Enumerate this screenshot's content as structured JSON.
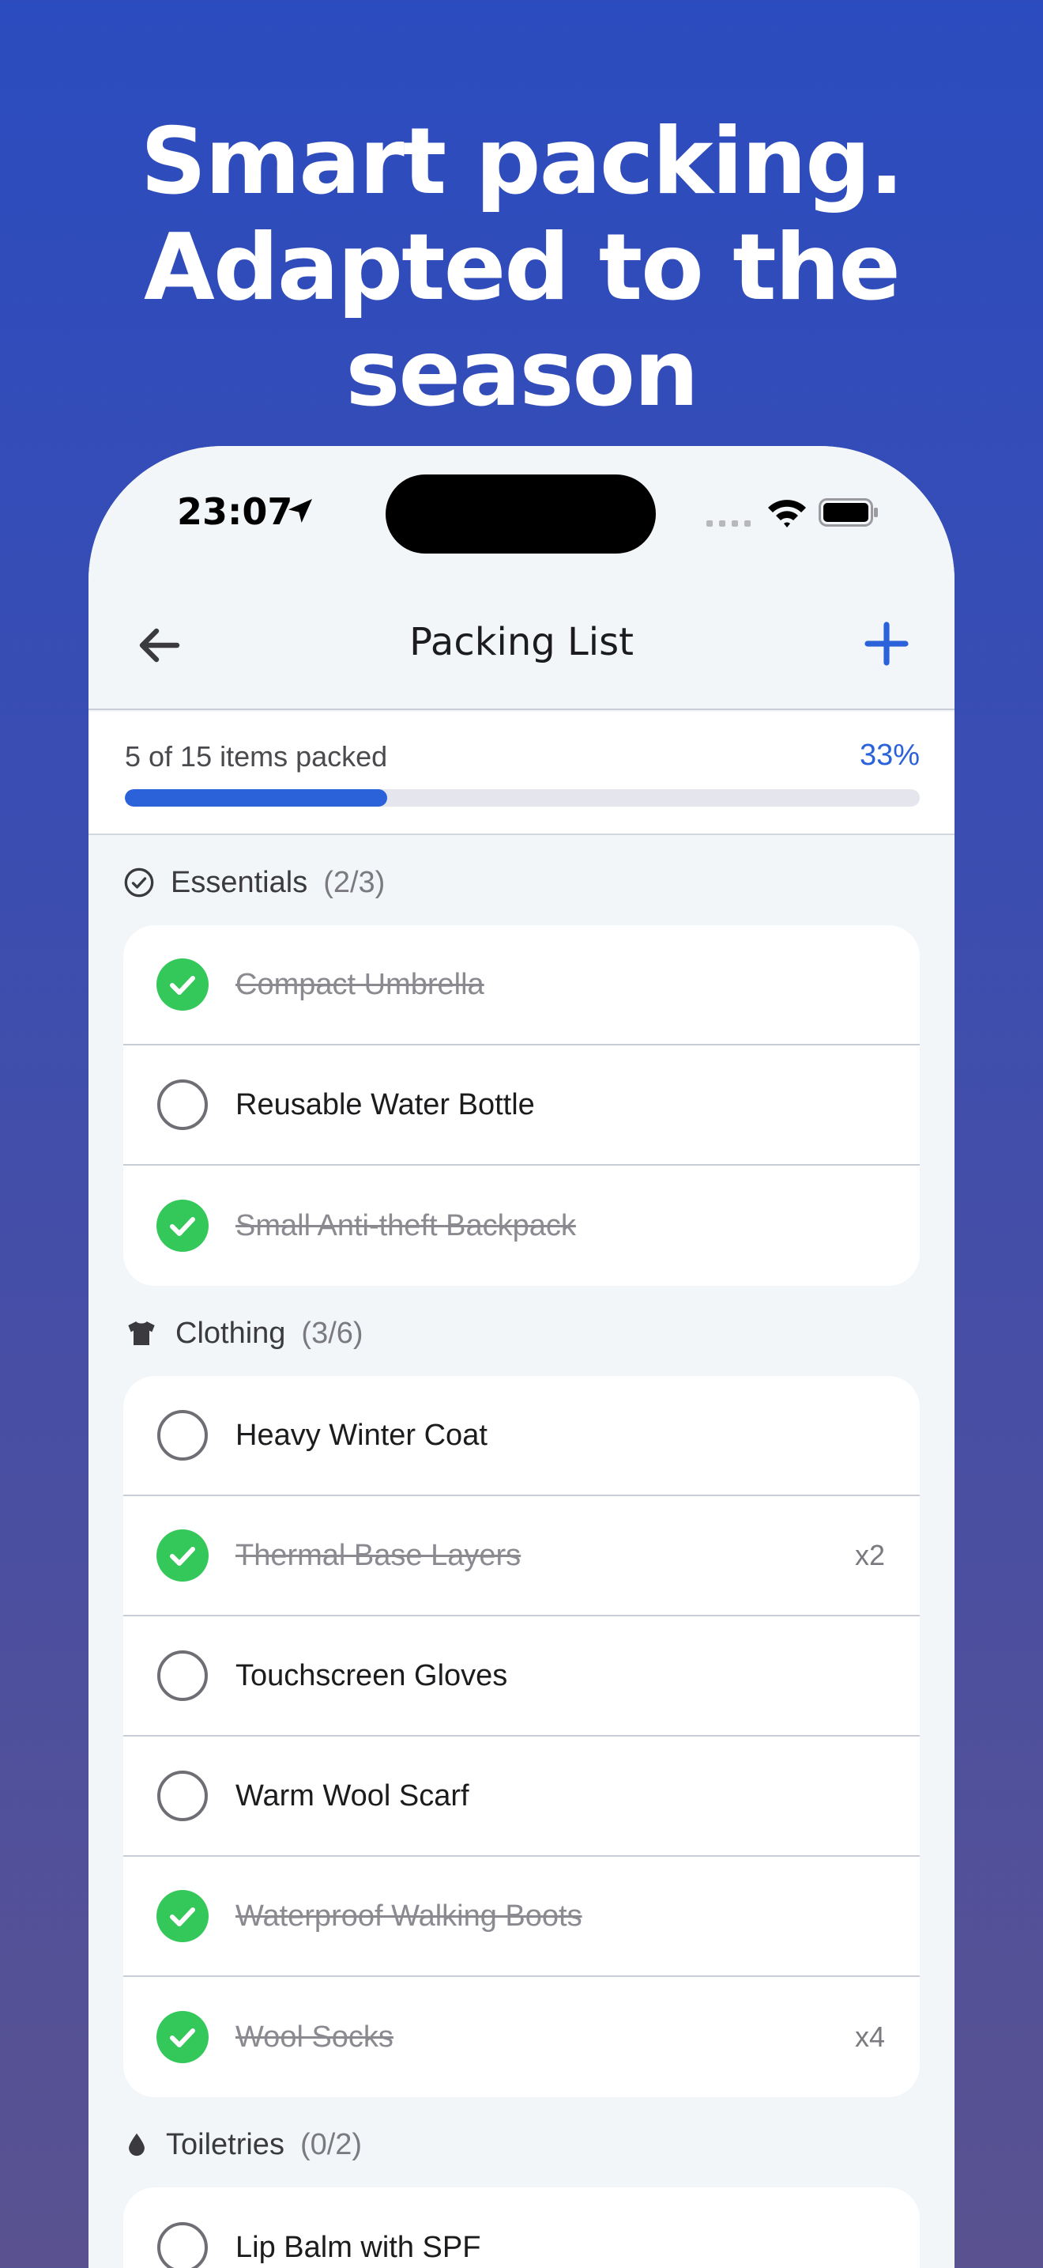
{
  "headline": [
    "Smart packing.",
    "Adapted to the",
    "season"
  ],
  "status": {
    "time": "23:07"
  },
  "nav": {
    "title": "Packing List"
  },
  "progress": {
    "text": "5 of 15 items packed",
    "percent_label": "33%",
    "fraction": 0.33
  },
  "colors": {
    "accent": "#2b62d9",
    "check": "#34c759",
    "bg_top": "#2b4cbf",
    "bg_bottom": "#5a5290"
  },
  "sections": [
    {
      "name": "Essentials",
      "count": "(2/3)",
      "icon": "check-circle-icon",
      "items": [
        {
          "label": "Compact Umbrella",
          "packed": true,
          "qty": ""
        },
        {
          "label": "Reusable Water Bottle",
          "packed": false,
          "qty": ""
        },
        {
          "label": "Small Anti-theft Backpack",
          "packed": true,
          "qty": ""
        }
      ]
    },
    {
      "name": "Clothing",
      "count": "(3/6)",
      "icon": "tshirt-icon",
      "items": [
        {
          "label": "Heavy Winter Coat",
          "packed": false,
          "qty": ""
        },
        {
          "label": "Thermal Base Layers",
          "packed": true,
          "qty": "x2"
        },
        {
          "label": "Touchscreen Gloves",
          "packed": false,
          "qty": ""
        },
        {
          "label": "Warm Wool Scarf",
          "packed": false,
          "qty": ""
        },
        {
          "label": "Waterproof Walking Boots",
          "packed": true,
          "qty": ""
        },
        {
          "label": "Wool Socks",
          "packed": true,
          "qty": "x4"
        }
      ]
    },
    {
      "name": "Toiletries",
      "count": "(0/2)",
      "icon": "drop-icon",
      "items": [
        {
          "label": "Lip Balm with SPF",
          "packed": false,
          "qty": ""
        }
      ]
    }
  ]
}
